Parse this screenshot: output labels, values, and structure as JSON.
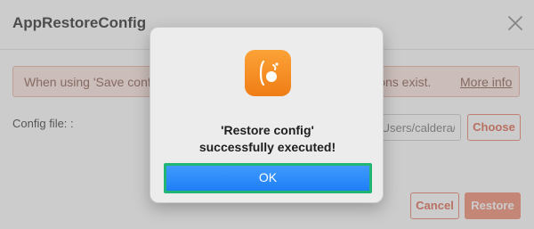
{
  "window": {
    "title": "AppRestoreConfig",
    "close_icon": "close-icon"
  },
  "warning": {
    "text": "When using 'Save config' & 'Restore config', the following limitations exist.",
    "link": "More info"
  },
  "config": {
    "label": "Config file: :",
    "path_value": "/Users/caldera/Downloads",
    "choose_label": "Choose"
  },
  "actions": {
    "cancel_label": "Cancel",
    "restore_label": "Restore"
  },
  "alert": {
    "icon": "app-icon",
    "message_line1": "'Restore config'",
    "message_line2": "successfully executed!",
    "ok_label": "OK"
  },
  "colors": {
    "accent": "#e0664d",
    "ok_button": "#1f7ef5",
    "focus_ring": "#21b573",
    "app_icon": "#f07d16"
  }
}
